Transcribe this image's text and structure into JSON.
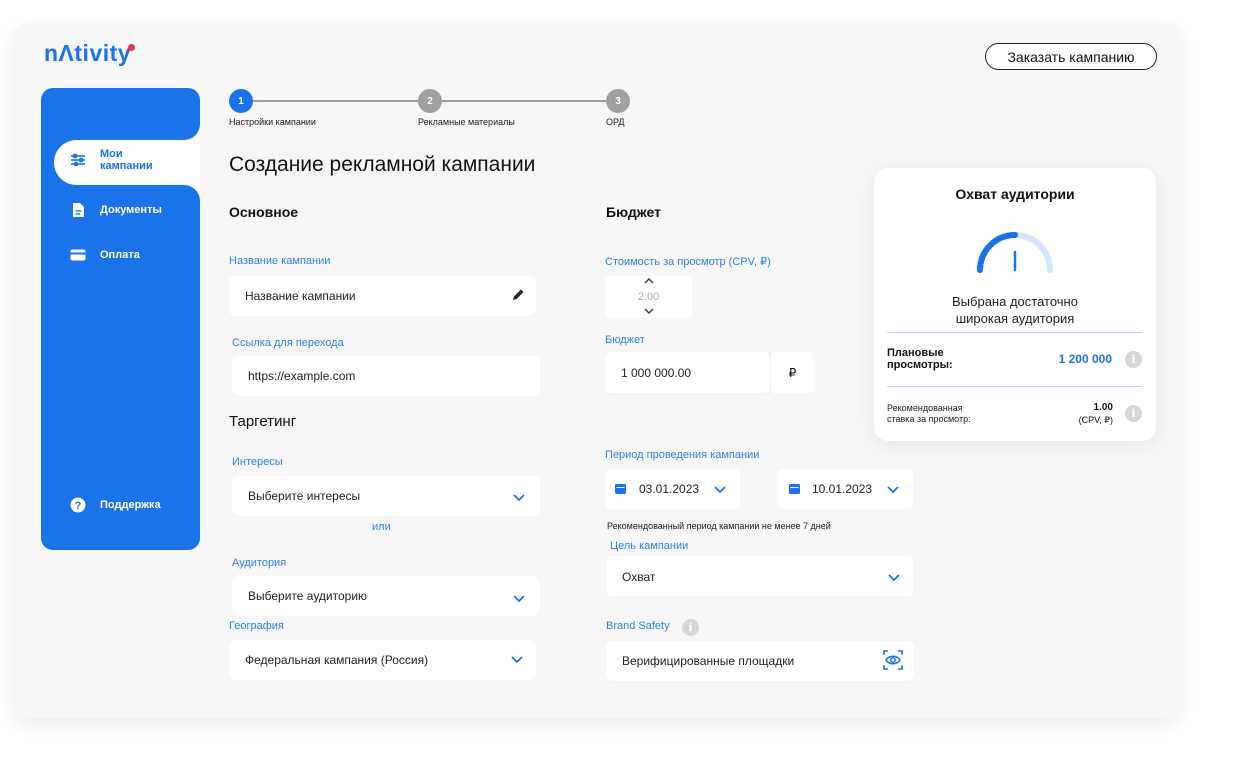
{
  "brand": {
    "logo_text": "nΛtivity",
    "accent": "#1a73e8"
  },
  "header": {
    "order_button": "Заказать кампанию"
  },
  "sidebar": {
    "items": [
      {
        "label": "Мои кампании",
        "icon": "sliders-icon",
        "active": true
      },
      {
        "label": "Документы",
        "icon": "document-icon"
      },
      {
        "label": "Оплата",
        "icon": "card-icon"
      }
    ],
    "support": {
      "label": "Поддержка",
      "icon": "help-icon"
    }
  },
  "stepper": {
    "steps": [
      {
        "num": "1",
        "label": "Настройки кампании",
        "active": true
      },
      {
        "num": "2",
        "label": "Рекламные материалы"
      },
      {
        "num": "3",
        "label": "ОРД"
      }
    ]
  },
  "page_title": "Создание рекламной кампании",
  "basic": {
    "title": "Основное",
    "name_label": "Название кампании",
    "name_value": "Название кампании",
    "link_label": "Ссылка для перехода",
    "link_value": "https://example.com"
  },
  "targeting": {
    "title": "Таргетинг",
    "interests_label": "Интересы",
    "interests_value": "Выберите интересы",
    "or_text": "или",
    "audience_label": "Аудитория",
    "audience_value": "Выберите аудиторию",
    "geo_label": "География",
    "geo_value": "Федеральная кампания (Россия)"
  },
  "budget": {
    "title": "Бюджет",
    "cpv_label": "Стоимость за просмотр  (CPV, ₽)",
    "cpv_value": "2.00",
    "budget_label": "Бюджет",
    "budget_value": "1 000 000.00",
    "currency": "₽",
    "period_label": "Период проведения кампании",
    "date_from": "03.01.2023",
    "date_to": "10.01.2023",
    "period_hint": "Рекомендованный период кампании не менее 7 дней",
    "goal_label": "Цель кампании",
    "goal_value": "Охват",
    "brand_safety_label": "Brand Safety",
    "brand_safety_value": "Верифицированные площадки"
  },
  "reach_card": {
    "title": "Охват аудитории",
    "gauge_level": 0.5,
    "status_line1": "Выбрана достаточно",
    "status_line2": "широкая аудитория",
    "planned_label_1": "Плановые",
    "planned_label_2": "просмотры:",
    "planned_value": "1 200 000",
    "rec_label_1": "Рекомендованная",
    "rec_label_2": "ставка за просмотр:",
    "rec_value": "1.00",
    "rec_unit": "(CPV, ₽)"
  }
}
